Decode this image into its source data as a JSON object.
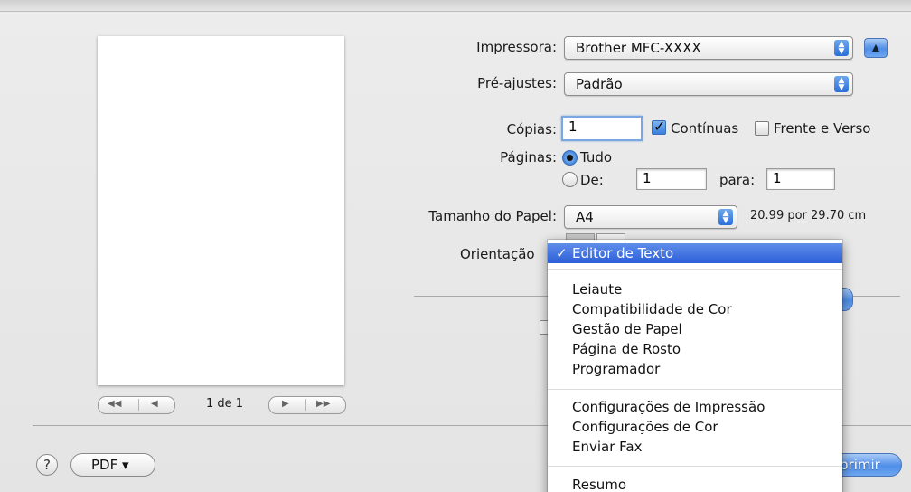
{
  "printer": {
    "label": "Impressora:",
    "value": "Brother MFC-XXXX"
  },
  "presets": {
    "label": "Pré-ajustes:",
    "value": "Padrão"
  },
  "copies": {
    "label": "Cópias:",
    "value": "1",
    "collated_label": "Contínuas",
    "collated_checked": true,
    "duplex_label": "Frente e Verso",
    "duplex_checked": false
  },
  "pages": {
    "label": "Páginas:",
    "all_label": "Tudo",
    "from_label": "De:",
    "from_value": "1",
    "to_label": "para:",
    "to_value": "1"
  },
  "paper_size": {
    "label": "Tamanho do Papel:",
    "value": "A4",
    "dimensions": "20.99 por 29.70 cm"
  },
  "orientation": {
    "label": "Orientação"
  },
  "menu": {
    "selected": "Editor de Texto",
    "checkmark": "✓",
    "group1": [
      "Leiaute",
      "Compatibilidade de Cor",
      "Gestão de Papel",
      "Página de Rosto",
      "Programador"
    ],
    "group2": [
      "Configurações de Impressão",
      "Configurações de Cor",
      "Enviar Fax"
    ],
    "group3": [
      "Resumo"
    ]
  },
  "preview_nav": {
    "page_indicator": "1 de 1"
  },
  "footer": {
    "help": "?",
    "pdf_label": "PDF ▾",
    "print_label": "primir"
  }
}
